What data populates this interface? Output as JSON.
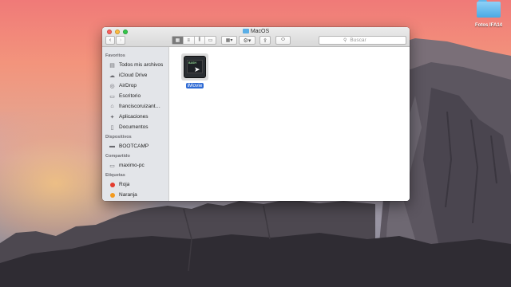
{
  "desktop": {
    "icon_label": "Fotos IFA14"
  },
  "window": {
    "title": "MacOS",
    "search_placeholder": "Buscar"
  },
  "sidebar": {
    "sections": [
      {
        "title": "Favoritos",
        "items": [
          {
            "label": "Todos mis archivos",
            "icon": "all-files-icon"
          },
          {
            "label": "iCloud Drive",
            "icon": "cloud-icon"
          },
          {
            "label": "AirDrop",
            "icon": "airdrop-icon"
          },
          {
            "label": "Escritorio",
            "icon": "desktop-icon"
          },
          {
            "label": "franciscoruizant…",
            "icon": "home-icon"
          },
          {
            "label": "Aplicaciones",
            "icon": "applications-icon"
          },
          {
            "label": "Documentos",
            "icon": "documents-icon"
          }
        ]
      },
      {
        "title": "Dispositivos",
        "items": [
          {
            "label": "BOOTCAMP",
            "icon": "drive-icon"
          }
        ]
      },
      {
        "title": "Compartido",
        "items": [
          {
            "label": "maximo-pc",
            "icon": "computer-icon"
          }
        ]
      },
      {
        "title": "Etiquetas",
        "items": [
          {
            "label": "Roja",
            "icon": "tag-dot-icon",
            "color": "#e33b2e"
          },
          {
            "label": "Naranja",
            "icon": "tag-dot-icon",
            "color": "#f39a1e"
          }
        ]
      }
    ]
  },
  "files": [
    {
      "label": "iMovie",
      "icon": "terminal-app-icon",
      "icon_text": "BASH",
      "selected": true
    }
  ]
}
